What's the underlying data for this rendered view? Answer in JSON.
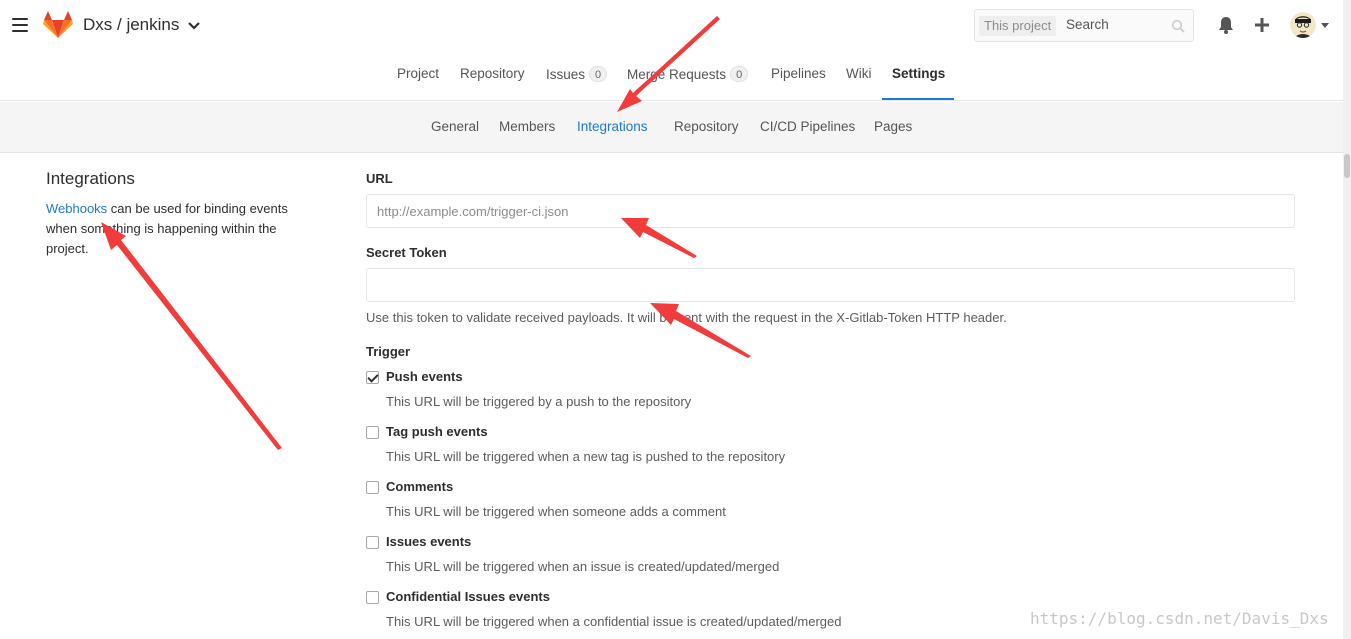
{
  "header": {
    "project_path": "Dxs / jenkins",
    "search_scope": "This project",
    "search_placeholder": "Search"
  },
  "nav": {
    "tabs": [
      {
        "label": "Project"
      },
      {
        "label": "Repository"
      },
      {
        "label": "Issues",
        "badge": "0"
      },
      {
        "label": "Merge Requests",
        "badge": "0"
      },
      {
        "label": "Pipelines"
      },
      {
        "label": "Wiki"
      },
      {
        "label": "Settings",
        "active": true
      }
    ]
  },
  "subnav": {
    "tabs": [
      {
        "label": "General"
      },
      {
        "label": "Members"
      },
      {
        "label": "Integrations",
        "active": true
      },
      {
        "label": "Repository"
      },
      {
        "label": "CI/CD Pipelines"
      },
      {
        "label": "Pages"
      }
    ]
  },
  "sidebar": {
    "title": "Integrations",
    "link_text": "Webhooks",
    "description": " can be used for binding events when something is happening within the project."
  },
  "form": {
    "url_label": "URL",
    "url_placeholder": "http://example.com/trigger-ci.json",
    "url_value": "",
    "token_label": "Secret Token",
    "token_value": "",
    "token_help": "Use this token to validate received payloads. It will be sent with the request in the X-Gitlab-Token HTTP header.",
    "trigger_label": "Trigger",
    "triggers": [
      {
        "label": "Push events",
        "help": "This URL will be triggered by a push to the repository",
        "checked": true
      },
      {
        "label": "Tag push events",
        "help": "This URL will be triggered when a new tag is pushed to the repository",
        "checked": false
      },
      {
        "label": "Comments",
        "help": "This URL will be triggered when someone adds a comment",
        "checked": false
      },
      {
        "label": "Issues events",
        "help": "This URL will be triggered when an issue is created/updated/merged",
        "checked": false
      },
      {
        "label": "Confidential Issues events",
        "help": "This URL will be triggered when a confidential issue is created/updated/merged",
        "checked": false
      }
    ]
  },
  "watermark": "https://blog.csdn.net/Davis_Dxs",
  "colors": {
    "accent": "#1f78d1",
    "annotation_arrow": "#f23c3c",
    "logo_orange": "#fc6d26"
  },
  "icons": [
    "menu-icon",
    "gitlab-logo-icon",
    "chevron-down-icon",
    "search-icon",
    "bell-icon",
    "plus-icon",
    "avatar"
  ]
}
